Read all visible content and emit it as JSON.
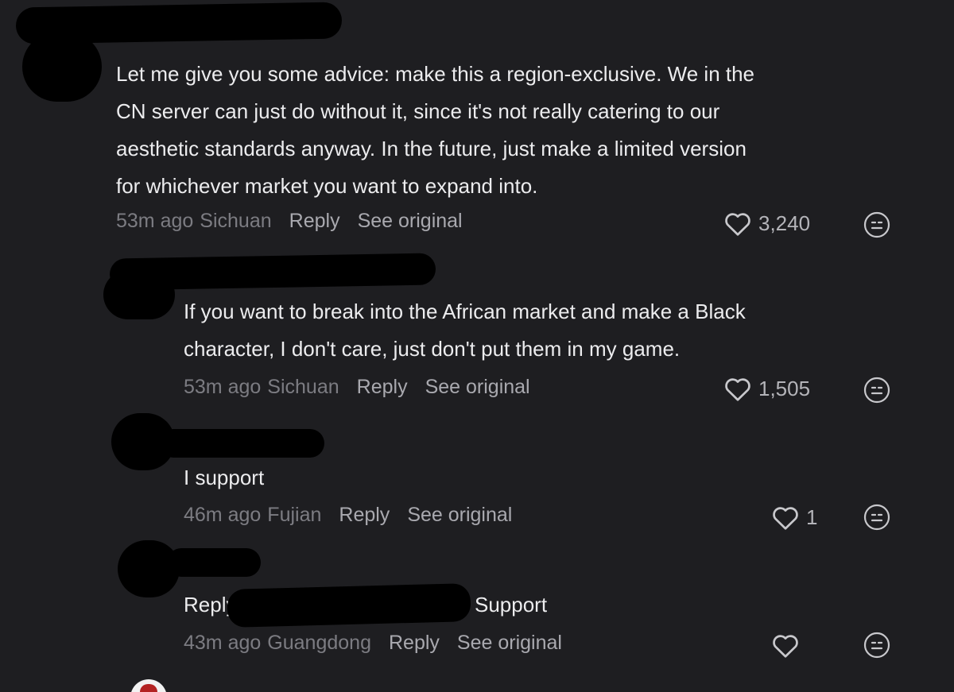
{
  "comments": [
    {
      "text_lines": [
        "Let me give you some advice: make this a region-exclusive. We in the",
        "CN server can just do without it, since it's not really catering to our",
        "aesthetic standards anyway. In the future, just make a limited version",
        "for whichever market you want to expand into."
      ],
      "time": "53m ago",
      "location": "Sichuan",
      "reply_label": "Reply",
      "see_original_label": "See original",
      "likes": "3,240"
    },
    {
      "text_lines": [
        "If you want to break into the African market and make a Black",
        "character, I don't care, just don't put them in my game."
      ],
      "time": "53m ago",
      "location": "Sichuan",
      "reply_label": "Reply",
      "see_original_label": "See original",
      "likes": "1,505"
    },
    {
      "text_lines": [
        "I support"
      ],
      "time": "46m ago",
      "location": "Fujian",
      "reply_label": "Reply",
      "see_original_label": "See original",
      "likes": "1"
    },
    {
      "reply_prefix": "Reply",
      "reply_text": "Support",
      "time": "43m ago",
      "location": "Guangdong",
      "reply_label": "Reply",
      "see_original_label": "See original",
      "likes": ""
    }
  ],
  "icons": {
    "like": "heart-outline-icon",
    "react": "neutral-face-icon"
  },
  "colors": {
    "background": "#1e1e21",
    "text": "#ececee",
    "muted": "#7c7c82",
    "action": "#a9a9af",
    "redaction": "#000000"
  }
}
